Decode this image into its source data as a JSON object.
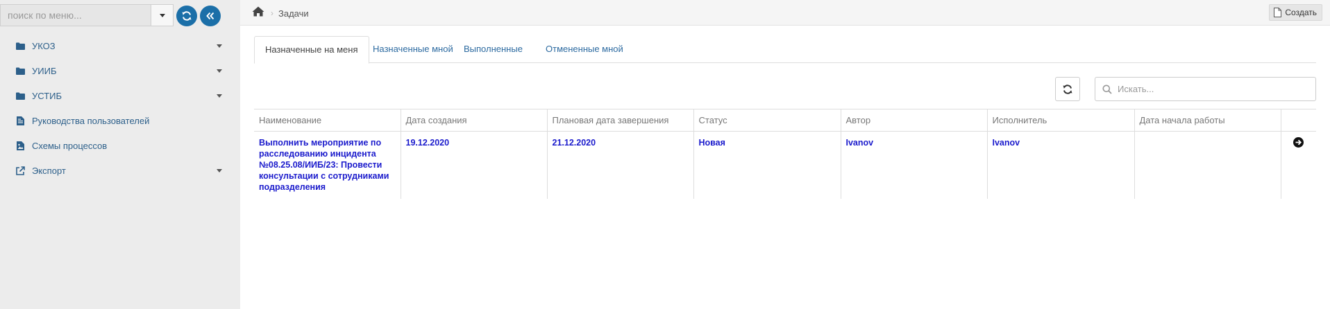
{
  "sidebar": {
    "search": {
      "placeholder": "поиск по меню...",
      "value": ""
    },
    "items": [
      {
        "label": "УКОЗ",
        "icon": "folder-icon",
        "has_submenu": true
      },
      {
        "label": "УИИБ",
        "icon": "folder-icon",
        "has_submenu": true
      },
      {
        "label": "УСТИБ",
        "icon": "folder-icon",
        "has_submenu": true
      },
      {
        "label": "Руководства пользователей",
        "icon": "document-icon",
        "has_submenu": false
      },
      {
        "label": "Схемы процессов",
        "icon": "image-icon",
        "has_submenu": false
      },
      {
        "label": "Экспорт",
        "icon": "external-link-icon",
        "has_submenu": true
      }
    ]
  },
  "breadcrumb": {
    "current": "Задачи"
  },
  "toolbar": {
    "create_label": "Создать"
  },
  "tabs": [
    {
      "label": "Назначенные на меня",
      "active": true
    },
    {
      "label": "Назначенные мной",
      "active": false
    },
    {
      "label": "Выполненные",
      "active": false
    },
    {
      "label": "Отмененные мной",
      "active": false
    }
  ],
  "table_search": {
    "placeholder": "Искать...",
    "value": ""
  },
  "table": {
    "columns": [
      "Наименование",
      "Дата создания",
      "Плановая дата завершения",
      "Статус",
      "Автор",
      "Исполнитель",
      "Дата начала работы",
      ""
    ],
    "rows": [
      {
        "name": "Выполнить мероприятие по расследованию инцидента №08.25.08/ИИБ/23: Провести консультации с сотрудниками подразделения",
        "created": "19.12.2020",
        "planned_end": "21.12.2020",
        "status": "Новая",
        "author": "Ivanov",
        "assignee": "Ivanov",
        "start_date": ""
      }
    ]
  },
  "colors": {
    "accent": "#1b6fa8",
    "link": "#1a1acc",
    "sidebar_bg": "#ececec"
  }
}
